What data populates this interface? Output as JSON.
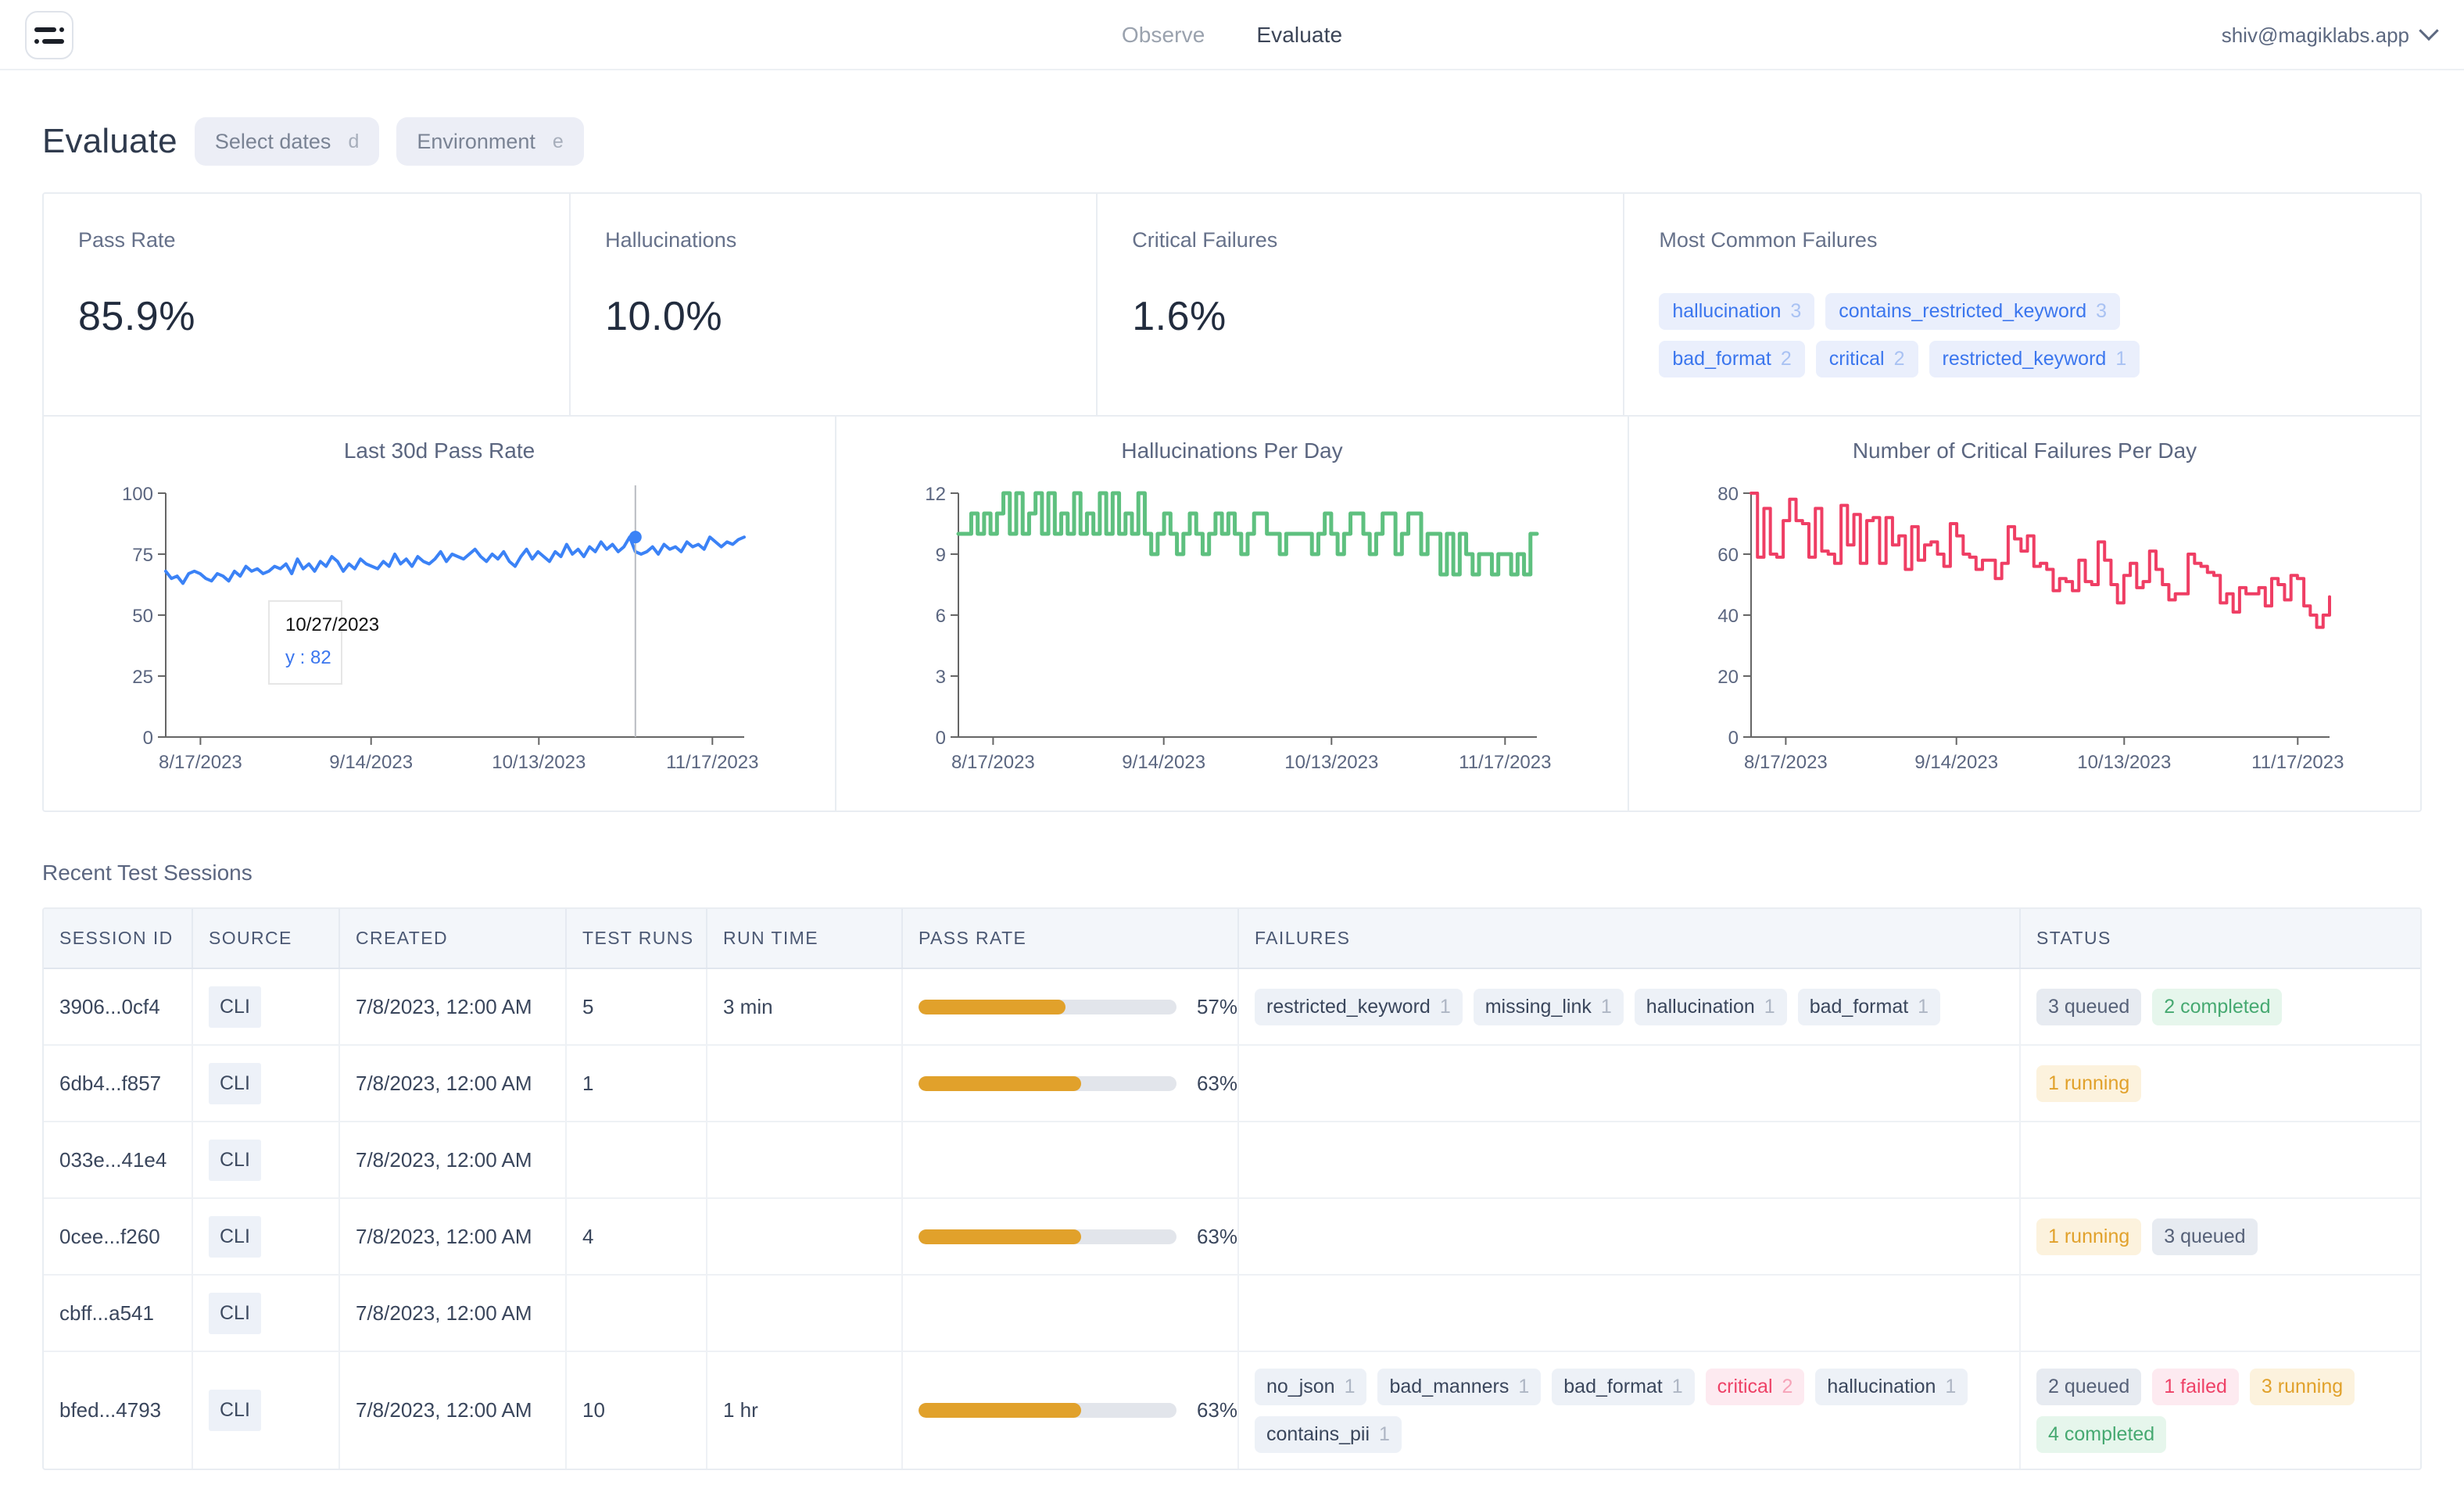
{
  "header": {
    "logo_name": "app-logo",
    "nav": [
      {
        "label": "Observe",
        "active": false
      },
      {
        "label": "Evaluate",
        "active": true
      }
    ],
    "account_email": "shiv@magiklabs.app"
  },
  "page": {
    "title": "Evaluate",
    "filters": [
      {
        "label": "Select dates",
        "key": "d"
      },
      {
        "label": "Environment",
        "key": "e"
      }
    ]
  },
  "kpis": [
    {
      "label": "Pass Rate",
      "value": "85.9%"
    },
    {
      "label": "Hallucinations",
      "value": "10.0%"
    },
    {
      "label": "Critical Failures",
      "value": "1.6%"
    }
  ],
  "most_common_failures": {
    "label": "Most Common Failures",
    "items": [
      {
        "name": "hallucination",
        "count": "3"
      },
      {
        "name": "contains_restricted_keyword",
        "count": "3"
      },
      {
        "name": "bad_format",
        "count": "2"
      },
      {
        "name": "critical",
        "count": "2"
      },
      {
        "name": "restricted_keyword",
        "count": "1"
      }
    ]
  },
  "tooltip": {
    "date": "10/27/2023",
    "value": "y : 82"
  },
  "chart_data": [
    {
      "type": "line",
      "title": "Last 30d Pass Rate",
      "xlabel": "",
      "ylabel": "",
      "ylim": [
        0,
        100
      ],
      "yticks": [
        "0",
        "25",
        "50",
        "75",
        "100"
      ],
      "xticks": [
        "8/17/2023",
        "9/14/2023",
        "10/13/2023",
        "11/17/2023"
      ],
      "color": "#3b82f6",
      "grid": false,
      "legend": "none",
      "annotation": {
        "date": "10/27/2023",
        "y": 82
      },
      "values": [
        68,
        65,
        66,
        63,
        67,
        68,
        67,
        65,
        64,
        67,
        66,
        64,
        68,
        66,
        70,
        68,
        69,
        67,
        68,
        70,
        69,
        71,
        67,
        73,
        69,
        71,
        68,
        72,
        70,
        74,
        72,
        68,
        71,
        69,
        73,
        71,
        70,
        69,
        72,
        70,
        75,
        71,
        73,
        70,
        74,
        72,
        71,
        73,
        76,
        72,
        75,
        74,
        73,
        75,
        77,
        74,
        72,
        75,
        73,
        76,
        72,
        70,
        74,
        77,
        73,
        76,
        74,
        72,
        76,
        74,
        79,
        75,
        77,
        74,
        78,
        76,
        80,
        77,
        79,
        76,
        78,
        82,
        76,
        75,
        76,
        78,
        75,
        79,
        77,
        78,
        76,
        80,
        78,
        79,
        77,
        82,
        80,
        78,
        80,
        79,
        81,
        82
      ]
    },
    {
      "type": "line",
      "title": "Hallucinations Per Day",
      "xlabel": "",
      "ylabel": "",
      "ylim": [
        0,
        12
      ],
      "yticks": [
        "0",
        "3",
        "6",
        "9",
        "12"
      ],
      "xticks": [
        "8/17/2023",
        "9/14/2023",
        "10/13/2023",
        "11/17/2023"
      ],
      "color": "#5ec07f",
      "grid": false,
      "legend": "none",
      "values": [
        10,
        10,
        11,
        10,
        11,
        10,
        11,
        12,
        10,
        12,
        10,
        11,
        12,
        10,
        12,
        10,
        11,
        10,
        12,
        10,
        11,
        10,
        12,
        10,
        12,
        10,
        11,
        10,
        12,
        10,
        9,
        10,
        11,
        10,
        9,
        10,
        11,
        10,
        9,
        10,
        11,
        10,
        11,
        10,
        9,
        10,
        11,
        11,
        10,
        10,
        9,
        10,
        10,
        10,
        10,
        9,
        10,
        11,
        10,
        9,
        10,
        11,
        11,
        10,
        9,
        10,
        11,
        11,
        9,
        10,
        11,
        11,
        9,
        10,
        10,
        8,
        10,
        8,
        10,
        9,
        8,
        9,
        9,
        8,
        9,
        9,
        8,
        9,
        8,
        10,
        10
      ]
    },
    {
      "type": "line",
      "title": "Number of Critical Failures Per Day",
      "xlabel": "",
      "ylabel": "",
      "ylim": [
        0,
        80
      ],
      "yticks": [
        "0",
        "20",
        "40",
        "60",
        "80"
      ],
      "xticks": [
        "8/17/2023",
        "9/14/2023",
        "10/13/2023",
        "11/17/2023"
      ],
      "color": "#ef3e64",
      "grid": false,
      "legend": "none",
      "values": [
        80,
        59,
        75,
        60,
        59,
        71,
        78,
        71,
        70,
        59,
        75,
        61,
        60,
        57,
        76,
        63,
        73,
        57,
        71,
        72,
        57,
        72,
        63,
        66,
        55,
        69,
        58,
        63,
        64,
        60,
        56,
        70,
        66,
        60,
        59,
        55,
        58,
        58,
        52,
        57,
        69,
        65,
        61,
        66,
        56,
        57,
        55,
        48,
        52,
        51,
        48,
        58,
        51,
        50,
        64,
        58,
        50,
        44,
        53,
        57,
        49,
        51,
        61,
        55,
        50,
        45,
        47,
        47,
        60,
        57,
        56,
        54,
        53,
        44,
        47,
        41,
        49,
        47,
        47,
        49,
        43,
        52,
        50,
        45,
        53,
        52,
        43,
        40,
        36,
        40,
        46
      ]
    }
  ],
  "table": {
    "section_title": "Recent Test Sessions",
    "columns": [
      "SESSION ID",
      "SOURCE",
      "CREATED",
      "TEST RUNS",
      "RUN TIME",
      "PASS RATE",
      "FAILURES",
      "STATUS"
    ],
    "rows": [
      {
        "session_id": "3906...0cf4",
        "source": "CLI",
        "created": "7/8/2023, 12:00 AM",
        "test_runs": "5",
        "run_time": "3 min",
        "pass_rate_pct": 57,
        "pass_rate_label": "57%",
        "failures": [
          {
            "name": "restricted_keyword",
            "count": "1",
            "severity": "normal"
          },
          {
            "name": "missing_link",
            "count": "1",
            "severity": "normal"
          },
          {
            "name": "hallucination",
            "count": "1",
            "severity": "normal"
          },
          {
            "name": "bad_format",
            "count": "1",
            "severity": "normal"
          }
        ],
        "status": [
          {
            "label": "3 queued",
            "kind": "queued"
          },
          {
            "label": "2 completed",
            "kind": "completed"
          }
        ]
      },
      {
        "session_id": "6db4...f857",
        "source": "CLI",
        "created": "7/8/2023, 12:00 AM",
        "test_runs": "1",
        "run_time": "",
        "pass_rate_pct": 63,
        "pass_rate_label": "63%",
        "failures": [],
        "status": [
          {
            "label": "1 running",
            "kind": "running"
          }
        ]
      },
      {
        "session_id": "033e...41e4",
        "source": "CLI",
        "created": "7/8/2023, 12:00 AM",
        "test_runs": "",
        "run_time": "",
        "pass_rate_pct": null,
        "pass_rate_label": "",
        "failures": [],
        "status": []
      },
      {
        "session_id": "0cee...f260",
        "source": "CLI",
        "created": "7/8/2023, 12:00 AM",
        "test_runs": "4",
        "run_time": "",
        "pass_rate_pct": 63,
        "pass_rate_label": "63%",
        "failures": [],
        "status": [
          {
            "label": "1 running",
            "kind": "running"
          },
          {
            "label": "3 queued",
            "kind": "queued"
          }
        ]
      },
      {
        "session_id": "cbff...a541",
        "source": "CLI",
        "created": "7/8/2023, 12:00 AM",
        "test_runs": "",
        "run_time": "",
        "pass_rate_pct": null,
        "pass_rate_label": "",
        "failures": [],
        "status": []
      },
      {
        "session_id": "bfed...4793",
        "source": "CLI",
        "created": "7/8/2023, 12:00 AM",
        "test_runs": "10",
        "run_time": "1 hr",
        "pass_rate_pct": 63,
        "pass_rate_label": "63%",
        "failures": [
          {
            "name": "no_json",
            "count": "1",
            "severity": "normal"
          },
          {
            "name": "bad_manners",
            "count": "1",
            "severity": "normal"
          },
          {
            "name": "bad_format",
            "count": "1",
            "severity": "normal"
          },
          {
            "name": "critical",
            "count": "2",
            "severity": "critical"
          },
          {
            "name": "hallucination",
            "count": "1",
            "severity": "normal"
          },
          {
            "name": "contains_pii",
            "count": "1",
            "severity": "normal"
          }
        ],
        "status": [
          {
            "label": "2 queued",
            "kind": "queued"
          },
          {
            "label": "1 failed",
            "kind": "failed"
          },
          {
            "label": "3 running",
            "kind": "running"
          },
          {
            "label": "4 completed",
            "kind": "completed"
          }
        ]
      }
    ]
  },
  "colors": {
    "pass_line": "#3b82f6",
    "hallucination_line": "#5ec07f",
    "critical_line": "#ef3e64",
    "progress_fill": "#e1a12b",
    "tag_blue": "#3b76ee"
  }
}
